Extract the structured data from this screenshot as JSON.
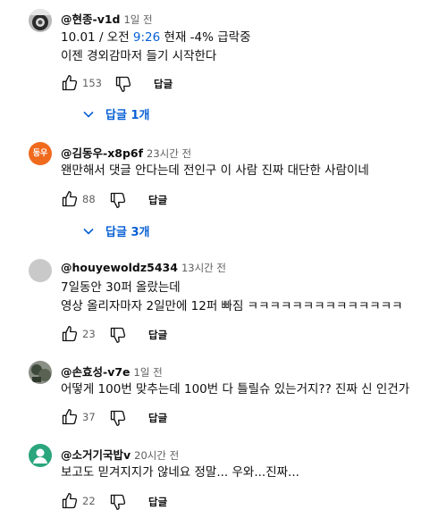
{
  "comments": [
    {
      "handle": "@현종-v1d",
      "time": "1일 전",
      "line1_pre": "10.01 / 오전 ",
      "line1_link": "9:26",
      "line1_post": " 현재 -4% 급락중",
      "line2": "이젠 경외감마저 들기 시작한다",
      "likes": "153",
      "reply_label": "답글",
      "replies_label": "답글 1개"
    },
    {
      "avatar_text": "동우",
      "handle": "@김동우-x8p6f",
      "time": "23시간 전",
      "line1": "왠만해서 댓글 안다는데 전인구 이 사람 진짜 대단한 사람이네",
      "likes": "88",
      "reply_label": "답글",
      "replies_label": "답글 3개"
    },
    {
      "handle": "@houyewoldz5434",
      "time": "13시간 전",
      "line1": "7일동안 30퍼 올랐는데",
      "line2": "영상 올리자마자 2일만에 12퍼 빠짐 ㅋㅋㅋㅋㅋㅋㅋㅋㅋㅋㅋㅋㅋㅋ",
      "likes": "23",
      "reply_label": "답글"
    },
    {
      "handle": "@손효성-v7e",
      "time": "1일 전",
      "line1": "어떻게 100번 맞추는데 100번 다 틀릴슈 있는거지?? 진짜 신 인건가",
      "likes": "37",
      "reply_label": "답글"
    },
    {
      "handle": "@소거기국밥v",
      "time": "20시간 전",
      "line1": "보고도 믿겨지지가 않네요 정말... 우와...진짜...",
      "likes": "22",
      "reply_label": "답글"
    }
  ],
  "colors": {
    "link": "#065fd4",
    "muted": "#606060",
    "orange_avatar": "#f06a1e",
    "green_avatar": "#2aa57d"
  }
}
